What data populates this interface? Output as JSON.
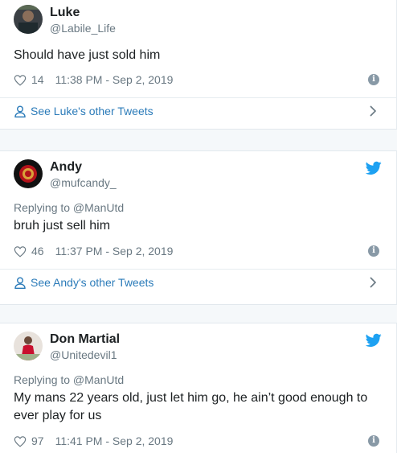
{
  "tweets": [
    {
      "name": "Luke",
      "handle": "@Labile_Life",
      "replying": "",
      "text": "Should have just sold him",
      "likes": "14",
      "timestamp": "11:38 PM - Sep 2, 2019",
      "see_more": "See Luke's other Tweets",
      "show_bird": false,
      "avatar_icon": "avatar-luke"
    },
    {
      "name": "Andy",
      "handle": "@mufcandy_",
      "replying": "Replying to @ManUtd",
      "text": "bruh just sell him",
      "likes": "46",
      "timestamp": "11:37 PM - Sep 2, 2019",
      "see_more": "See Andy's other Tweets",
      "show_bird": true,
      "avatar_icon": "avatar-andy"
    },
    {
      "name": "Don Martial",
      "handle": "@Unitedevil1",
      "replying": "Replying to @ManUtd",
      "text_line1": "My mans 22 years old, just let him go, he ain’t good enough to",
      "text_line2": "ever play for us",
      "likes": "97",
      "timestamp": "11:41 PM - Sep 2, 2019",
      "show_bird": true,
      "avatar_icon": "avatar-don"
    }
  ],
  "colors": {
    "twitter_blue": "#1da1f2",
    "link_blue": "#2b7bb9",
    "muted": "#697882",
    "divider": "#e6ecf0",
    "gap_bg": "#f5f8fa"
  },
  "info_glyph": "i"
}
